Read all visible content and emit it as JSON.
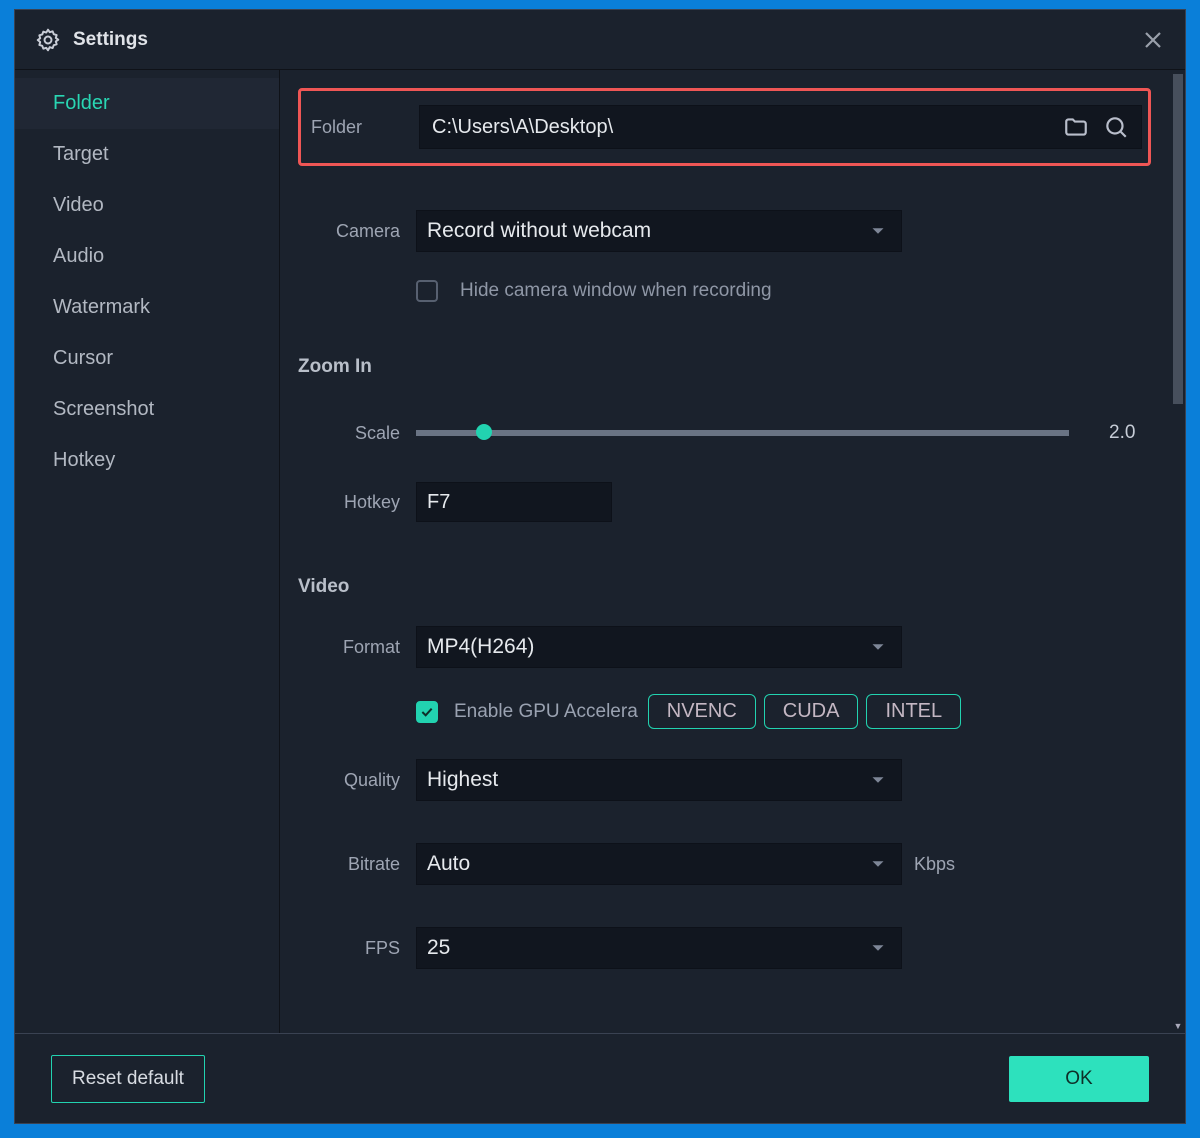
{
  "title": "Settings",
  "sidebar": {
    "items": [
      {
        "label": "Folder",
        "active": true
      },
      {
        "label": "Target"
      },
      {
        "label": "Video"
      },
      {
        "label": "Audio"
      },
      {
        "label": "Watermark"
      },
      {
        "label": "Cursor"
      },
      {
        "label": "Screenshot"
      },
      {
        "label": "Hotkey"
      }
    ]
  },
  "folder": {
    "label": "Folder",
    "path": "C:\\Users\\A\\Desktop\\"
  },
  "camera": {
    "label": "Camera",
    "value": "Record without webcam",
    "hide_label": "Hide camera window when recording",
    "hide_checked": false
  },
  "zoom": {
    "heading": "Zoom In",
    "scale_label": "Scale",
    "scale_value": "2.0",
    "hotkey_label": "Hotkey",
    "hotkey_value": "F7"
  },
  "video": {
    "heading": "Video",
    "format_label": "Format",
    "format_value": "MP4(H264)",
    "gpu_enable_label": "Enable GPU Accelera",
    "gpu_checked": true,
    "gpu_options": [
      "NVENC",
      "CUDA",
      "INTEL"
    ],
    "quality_label": "Quality",
    "quality_value": "Highest",
    "bitrate_label": "Bitrate",
    "bitrate_value": "Auto",
    "bitrate_unit": "Kbps",
    "fps_label": "FPS",
    "fps_value": "25"
  },
  "footer": {
    "reset": "Reset default",
    "ok": "OK"
  },
  "colors": {
    "accent": "#22d3b0",
    "highlight": "#ef5655"
  }
}
